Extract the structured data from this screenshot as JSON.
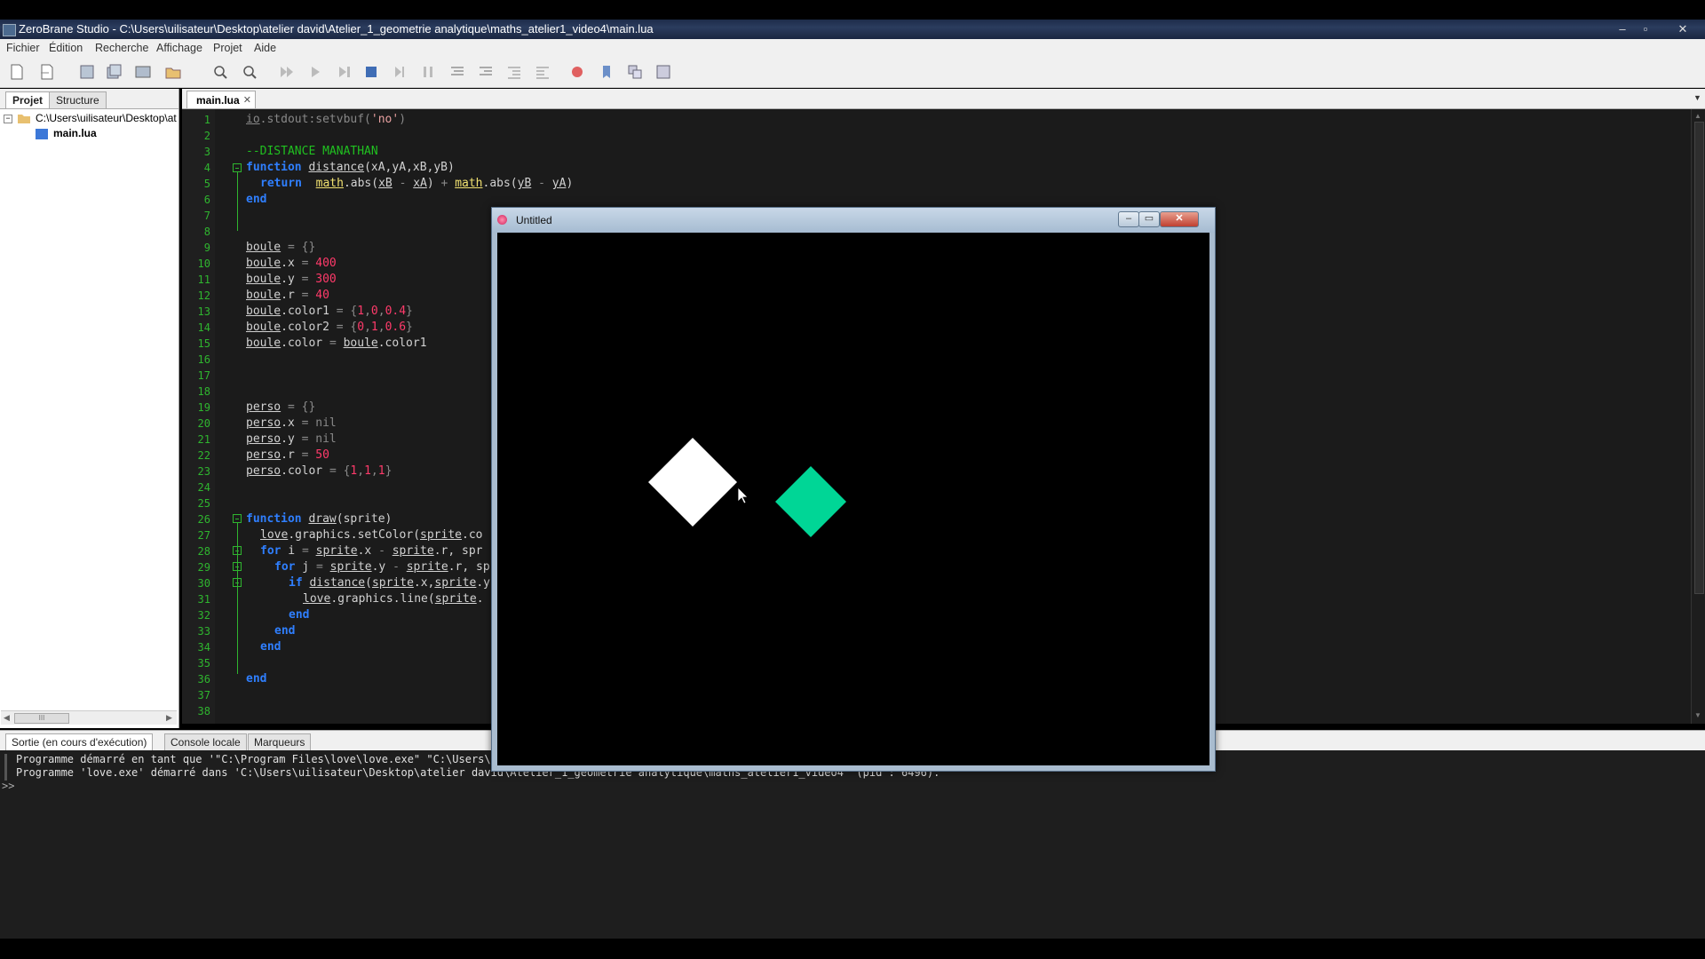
{
  "window": {
    "title": "ZeroBrane Studio - C:\\Users\\uilisateur\\Desktop\\atelier david\\Atelier_1_geometrie analytique\\maths_atelier1_video4\\main.lua",
    "controls": [
      "–",
      "▫",
      "✕"
    ]
  },
  "menu": [
    "Fichier",
    "Édition",
    "Recherche",
    "Affichage",
    "Projet",
    "Aide"
  ],
  "left_panel": {
    "tabs": [
      "Projet",
      "Structure"
    ],
    "root": "C:\\Users\\uilisateur\\Desktop\\at",
    "file": "main.lua",
    "scroll_mark": "III"
  },
  "editor": {
    "tab": "main.lua",
    "tab_close": "✕",
    "lines": [
      {
        "n": "1"
      },
      {
        "n": "2"
      },
      {
        "n": "3"
      },
      {
        "n": "4"
      },
      {
        "n": "5"
      },
      {
        "n": "6"
      },
      {
        "n": "7"
      },
      {
        "n": "8"
      },
      {
        "n": "9"
      },
      {
        "n": "10"
      },
      {
        "n": "11"
      },
      {
        "n": "12"
      },
      {
        "n": "13"
      },
      {
        "n": "14"
      },
      {
        "n": "15"
      },
      {
        "n": "16"
      },
      {
        "n": "17"
      },
      {
        "n": "18"
      },
      {
        "n": "19"
      },
      {
        "n": "20"
      },
      {
        "n": "21"
      },
      {
        "n": "22"
      },
      {
        "n": "23"
      },
      {
        "n": "24"
      },
      {
        "n": "25"
      },
      {
        "n": "26"
      },
      {
        "n": "27"
      },
      {
        "n": "28"
      },
      {
        "n": "29"
      },
      {
        "n": "30"
      },
      {
        "n": "31"
      },
      {
        "n": "32"
      },
      {
        "n": "33"
      },
      {
        "n": "34"
      },
      {
        "n": "35"
      },
      {
        "n": "36"
      },
      {
        "n": "37"
      },
      {
        "n": "38"
      }
    ],
    "code": {
      "l1": "io.stdout:setvbuf('no')",
      "l3": "--DISTANCE MANATHAN",
      "l4": "function distance(xA,yA,xB,yB)",
      "l5": "return  math.abs(xB - xA) + math.abs(yB - yA)",
      "l6": "end",
      "l9": "boule = {}",
      "l10": "boule.x = 400",
      "l11": "boule.y = 300",
      "l12": "boule.r = 40",
      "l13": "boule.color1 = {1,0,0.4}",
      "l14": "boule.color2 = {0,1,0.6}",
      "l15": "boule.color = boule.color1",
      "l19": "perso = {}",
      "l20": "perso.x = nil",
      "l21": "perso.y = nil",
      "l22": "perso.r = 50",
      "l23": "perso.color = {1,1,1}",
      "l26": "function draw(sprite)",
      "l27": "love.graphics.setColor(sprite.co",
      "l28": "for i = sprite.x - sprite.r, spr",
      "l29": "for j = sprite.y - sprite.r, sp",
      "l30": "if distance(sprite.x,sprite.y",
      "l31": "love.graphics.line(sprite.",
      "l32": "end",
      "l33": "end",
      "l34": "end",
      "l36": "end"
    }
  },
  "bottom_panel": {
    "tabs": [
      "Sortie (en cours d'exécution)",
      "Console locale",
      "Marqueurs"
    ],
    "output": [
      "Programme démarré en tant que '\"C:\\Program Files\\love\\love.exe\" \"C:\\Users\\ui",
      "Programme 'love.exe' démarré dans 'C:\\Users\\uilisateur\\Desktop\\atelier david\\Atelier_1_geometrie analytique\\maths_atelier1_video4' (pid : 6496)."
    ],
    "prompt": ">>"
  },
  "popup": {
    "title": "Untitled",
    "controls": [
      "–",
      "▭",
      "✕"
    ],
    "shapes": [
      {
        "name": "perso",
        "color": "#ffffff"
      },
      {
        "name": "boule",
        "color": "#00d696"
      }
    ]
  },
  "colors": {
    "editor_bg": "#1b1b1b",
    "keyword": "#2f7fff",
    "comment": "#20c020",
    "number": "#ff3a6a",
    "line_number": "#2fb52f"
  }
}
